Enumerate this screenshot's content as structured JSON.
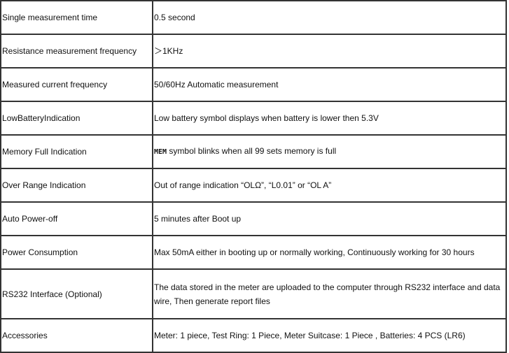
{
  "rows": [
    {
      "label": "Single measurement time",
      "value": "0.5 second"
    },
    {
      "label": "Resistance measurement frequency",
      "value": "＞1KHz"
    },
    {
      "label": "Measured current frequency",
      "value": "50/60Hz Automatic measurement"
    },
    {
      "label": "LowBatteryIndication",
      "value": "Low battery symbol displays when battery is lower then 5.3V"
    },
    {
      "label": "Memory Full Indication",
      "value_symbol": "MEM",
      "value": " symbol blinks when all 99 sets memory is full"
    },
    {
      "label": "Over Range Indication",
      "value": "Out of range indication “OLΩ”, “L0.01” or “OL A”"
    },
    {
      "label": "Auto Power-off",
      "value": "5 minutes after Boot up"
    },
    {
      "label": "Power Consumption",
      "value": "Max 50mA either in booting up or normally working, Continuously working for 30 hours"
    },
    {
      "label": "RS232 Interface (Optional)",
      "value": "The data stored in the meter are uploaded to the computer through RS232 interface and data wire, Then generate report files"
    },
    {
      "label": "Accessories",
      "value": "Meter: 1 piece, Test Ring: 1 Piece, Meter Suitcase: 1 Piece , Batteries: 4 PCS (LR6)"
    }
  ]
}
